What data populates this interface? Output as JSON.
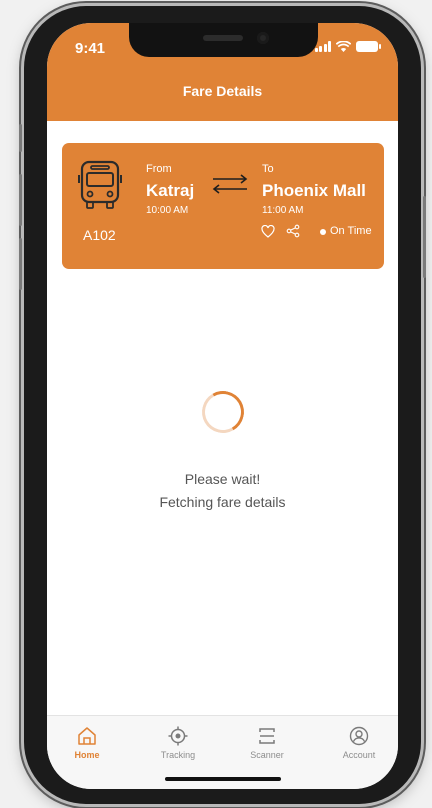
{
  "status_bar": {
    "time": "9:41"
  },
  "header": {
    "title": "Fare Details"
  },
  "route_card": {
    "route_number": "A102",
    "from_label": "From",
    "from_stop": "Katraj",
    "from_time": "10:00 AM",
    "to_label": "To",
    "to_stop": "Phoenix Mall",
    "to_time": "11:00 AM",
    "status": "On Time"
  },
  "loading": {
    "line1": "Please wait!",
    "line2": "Fetching fare details"
  },
  "bottom_nav": {
    "items": [
      {
        "label": "Home",
        "icon": "home-icon",
        "active": true
      },
      {
        "label": "Tracking",
        "icon": "tracking-icon",
        "active": false
      },
      {
        "label": "Scanner",
        "icon": "scanner-icon",
        "active": false
      },
      {
        "label": "Account",
        "icon": "account-icon",
        "active": false
      }
    ]
  },
  "colors": {
    "accent": "#e08336",
    "text_muted": "#555555",
    "nav_inactive": "#8d8d8d"
  }
}
